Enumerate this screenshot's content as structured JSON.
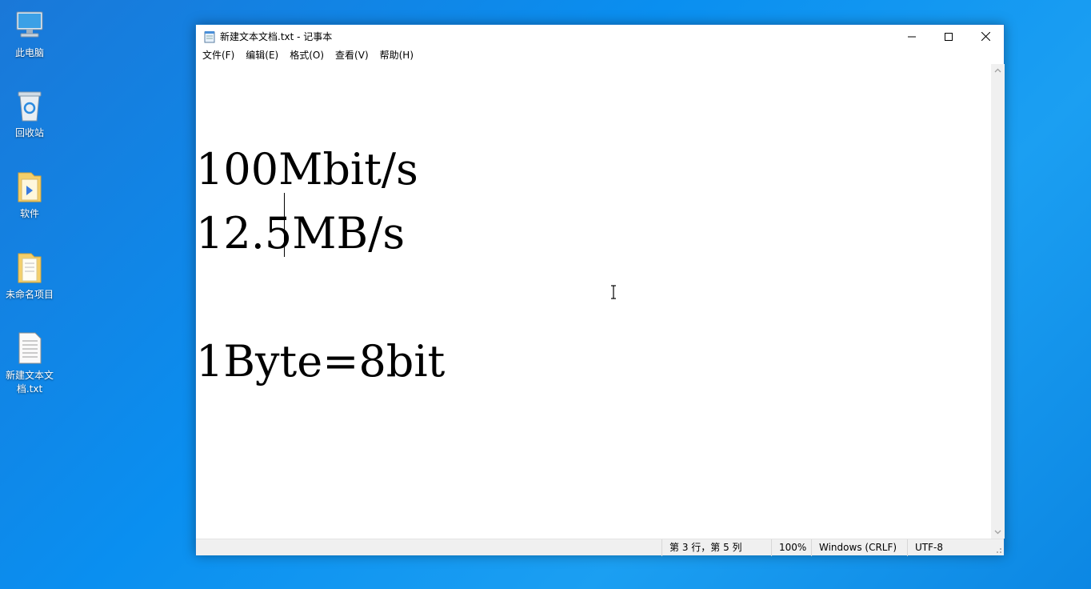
{
  "desktop": {
    "icons": [
      {
        "label": "此电脑",
        "icon": "computer-icon"
      },
      {
        "label": "回收站",
        "icon": "recycle-bin-icon"
      },
      {
        "label": "软件",
        "icon": "folder-icon"
      },
      {
        "label": "未命名项目",
        "icon": "folder-icon"
      },
      {
        "label": "新建文本文档.txt",
        "icon": "text-file-icon"
      }
    ]
  },
  "window": {
    "title": "新建文本文档.txt - 记事本",
    "controls": {
      "minimize": "minimize-icon",
      "maximize": "maximize-icon",
      "close": "close-icon"
    }
  },
  "menu": {
    "file": "文件(F)",
    "edit": "编辑(E)",
    "format": "格式(O)",
    "view": "查看(V)",
    "help": "帮助(H)"
  },
  "editor": {
    "lines": [
      "",
      "100Mbit/s",
      "12.5MB/s",
      "",
      "1Byte=8bit"
    ]
  },
  "status": {
    "position": "第 3 行，第 5 列",
    "zoom": "100%",
    "line_ending": "Windows (CRLF)",
    "encoding": "UTF-8"
  },
  "colors": {
    "desktop_bg": "#0a8ff0",
    "window_border": "#1979ca",
    "statusbar_bg": "#f0f0f0"
  }
}
